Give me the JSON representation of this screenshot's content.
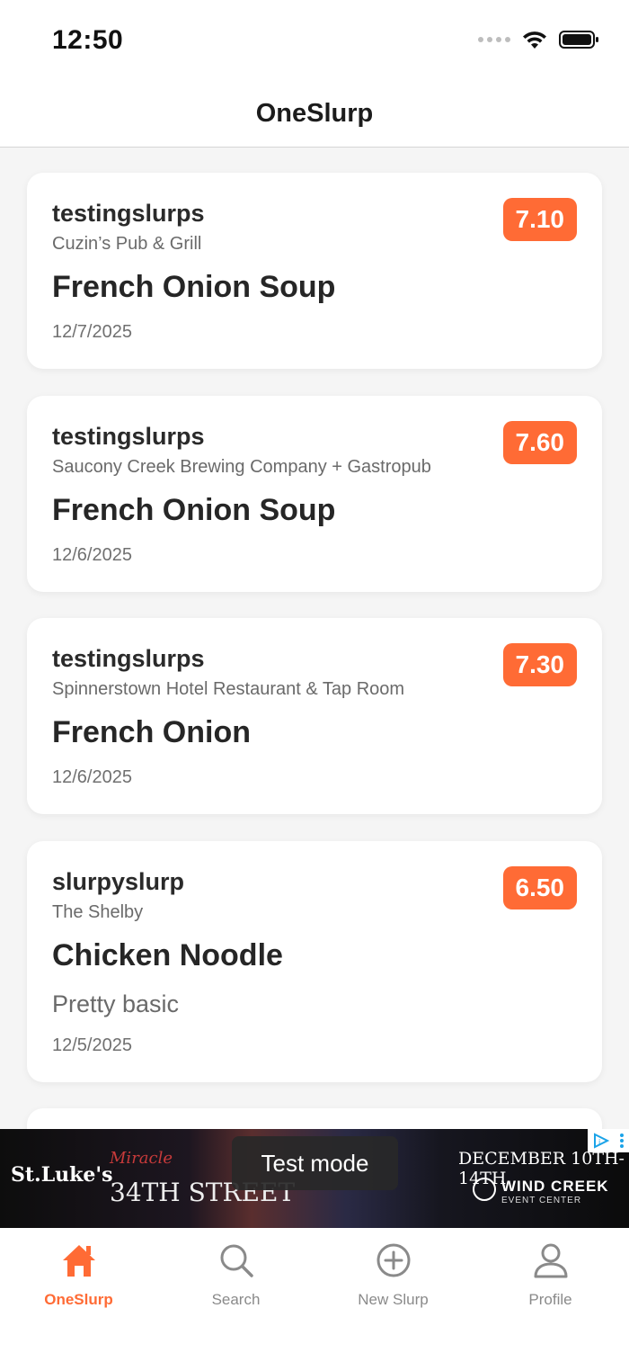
{
  "status_bar": {
    "time": "12:50"
  },
  "header": {
    "title": "OneSlurp"
  },
  "slurps": [
    {
      "user": "testingslurps",
      "place": "Cuzin’s Pub & Grill",
      "dish": "French Onion Soup",
      "note": "",
      "date": "12/7/2025",
      "score": "7.10"
    },
    {
      "user": "testingslurps",
      "place": "Saucony Creek Brewing Company + Gastropub",
      "dish": "French Onion Soup",
      "note": "",
      "date": "12/6/2025",
      "score": "7.60"
    },
    {
      "user": "testingslurps",
      "place": "Spinnerstown Hotel Restaurant & Tap Room",
      "dish": "French Onion",
      "note": "",
      "date": "12/6/2025",
      "score": "7.30"
    },
    {
      "user": "slurpyslurp",
      "place": "The Shelby",
      "dish": "Chicken Noodle",
      "note": "Pretty basic",
      "date": "12/5/2025",
      "score": "6.50"
    }
  ],
  "ad": {
    "test_mode_label": "Test mode",
    "sponsor": "St.Luke's",
    "miracle": "Miracle",
    "show": "34TH STREET",
    "dates": "DECEMBER 10TH-14TH",
    "venue": "WIND CREEK",
    "venue_sub": "EVENT CENTER"
  },
  "tabs": [
    {
      "label": "OneSlurp",
      "icon": "home-icon",
      "active": true
    },
    {
      "label": "Search",
      "icon": "search-icon",
      "active": false
    },
    {
      "label": "New Slurp",
      "icon": "plus-circle-icon",
      "active": false
    },
    {
      "label": "Profile",
      "icon": "person-icon",
      "active": false
    }
  ],
  "colors": {
    "accent": "#ff6b35",
    "background": "#f5f5f5",
    "card": "#ffffff"
  }
}
